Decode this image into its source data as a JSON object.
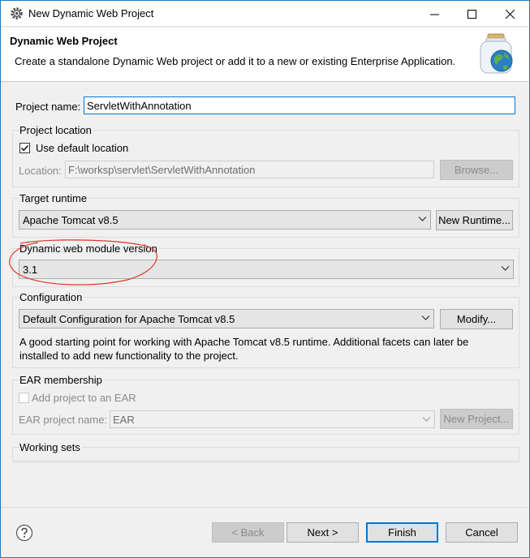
{
  "window": {
    "title": "New Dynamic Web Project"
  },
  "header": {
    "title": "Dynamic Web Project",
    "description": "Create a standalone Dynamic Web project or add it to a new or existing Enterprise Application."
  },
  "project_name": {
    "label": "Project name:",
    "value": "ServletWithAnnotation"
  },
  "project_location": {
    "group_label": "Project location",
    "use_default_label": "Use default location",
    "use_default_checked": true,
    "location_label": "Location:",
    "location_value": "F:\\worksp\\servlet\\ServletWithAnnotation",
    "browse_label": "Browse..."
  },
  "target_runtime": {
    "group_label": "Target runtime",
    "selected": "Apache Tomcat v8.5",
    "new_runtime_label": "New Runtime..."
  },
  "module_version": {
    "group_label": "Dynamic web module version",
    "selected": "3.1"
  },
  "configuration": {
    "group_label": "Configuration",
    "selected": "Default Configuration for Apache Tomcat v8.5",
    "modify_label": "Modify...",
    "description_line1": "A good starting point for working with Apache Tomcat v8.5 runtime. Additional facets can later be",
    "description_line2": "installed to add new functionality to the project."
  },
  "ear": {
    "group_label": "EAR membership",
    "add_label": "Add project to an EAR",
    "add_checked": false,
    "project_name_label": "EAR project name:",
    "project_name_value": "EAR",
    "new_project_label": "New Project..."
  },
  "working_sets": {
    "group_label": "Working sets"
  },
  "footer": {
    "back_label": "< Back",
    "next_label": "Next >",
    "finish_label": "Finish",
    "cancel_label": "Cancel"
  },
  "colors": {
    "accent": "#0078d7",
    "annotation": "#e0352b"
  }
}
